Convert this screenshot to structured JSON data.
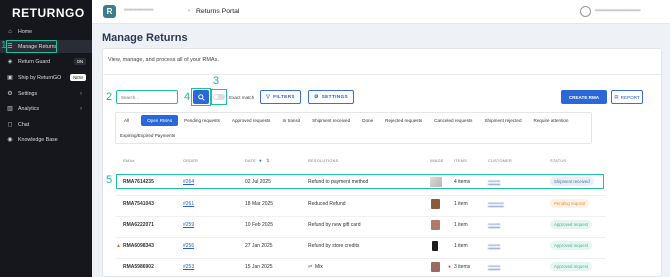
{
  "sidebar": {
    "logo_main": "RETURN",
    "logo_go": "GO",
    "items": [
      {
        "label": "Home",
        "icon": "home-icon",
        "glyph": "⌂"
      },
      {
        "label": "Manage Returns",
        "icon": "returns-icon",
        "glyph": "☰"
      },
      {
        "label": "Return Guard",
        "icon": "shield-icon",
        "glyph": "◈",
        "badge": "ON"
      },
      {
        "label": "Ship by ReturnGO",
        "icon": "truck-icon",
        "glyph": "▣",
        "badge": "NEW"
      },
      {
        "label": "Settings",
        "icon": "gear-icon",
        "glyph": "⚙",
        "chevron": "›"
      },
      {
        "label": "Analytics",
        "icon": "chart-icon",
        "glyph": "▥",
        "chevron": "›"
      },
      {
        "label": "Chat",
        "icon": "chat-icon",
        "glyph": "◻"
      },
      {
        "label": "Knowledge Base",
        "icon": "book-icon",
        "glyph": "◉"
      }
    ]
  },
  "markers": {
    "m1": "1",
    "m2": "2",
    "m3": "3",
    "m4": "4",
    "m5": "5"
  },
  "topbar": {
    "app_icon": "R",
    "store_name": "••••••••••••••",
    "separator": "›",
    "portal": "Returns Portal",
    "user_email": "••••••••••••••••••••••••••"
  },
  "main": {
    "title": "Manage Returns",
    "subtitle": "View, manage, and process all of your RMAs.",
    "search_placeholder": "Search...",
    "search_icon": "search-icon",
    "exact_match": "Exact match",
    "filters_btn": "FILTERS",
    "settings_btn": "SETTINGS",
    "create_btn": "CREATE RMA",
    "report_btn": "REPORT"
  },
  "filters": {
    "row1": [
      "All",
      "Open RMAs",
      "Pending requests",
      "Approved requests",
      "In transit",
      "Shipment received",
      "Done",
      "Rejected requests",
      "Canceled requests",
      "Shipment rejected",
      "Require attention"
    ],
    "row2": [
      "Expiring/Expired Payments"
    ],
    "active": "Open RMAs"
  },
  "table": {
    "headers": {
      "rma": "RMA#",
      "order": "ORDER",
      "date": "DATE",
      "resolutions": "RESOLUTIONS",
      "image": "IMAGE",
      "items": "ITEMS",
      "customer": "CUSTOMER",
      "status": "STATUS"
    },
    "rows": [
      {
        "rma": "RMA7614235",
        "order": "#264",
        "date": "02 Jul 2025",
        "resolution": "Refund to payment method",
        "items": "4 items",
        "customer": "•••••••",
        "status": "Shipment received",
        "status_kind": "shipment",
        "thumb": "#c9c3bd"
      },
      {
        "rma": "RMA7541043",
        "order": "#261",
        "date": "18 Mar 2025",
        "resolution": "Reduced Refund",
        "items": "1 item",
        "customer": "•••••••••",
        "status": "Pending request",
        "status_kind": "pending",
        "thumb": "#8a5a3c"
      },
      {
        "rma": "RMA6222071",
        "order": "#259",
        "date": "10 Feb 2025",
        "resolution": "Refund by new gift card",
        "items": "1 item",
        "customer": "•••••••",
        "status": "Approved request",
        "status_kind": "approved",
        "thumb": "#b07a6a"
      },
      {
        "rma": "RMA6098343",
        "order": "#256",
        "date": "27 Jan 2025",
        "resolution": "Refund by store credits",
        "items": "1 item",
        "customer": "•••••••",
        "status": "Approved request",
        "status_kind": "approved",
        "thumb": "#1c1c1c"
      },
      {
        "rma": "RMA5986902",
        "order": "#253",
        "date": "15 Jan 2025",
        "resolution": "Mix",
        "items": "3 items",
        "customer": "•••••••",
        "status": "Approved request",
        "status_kind": "approved",
        "thumb": "#9a6a60"
      }
    ]
  }
}
